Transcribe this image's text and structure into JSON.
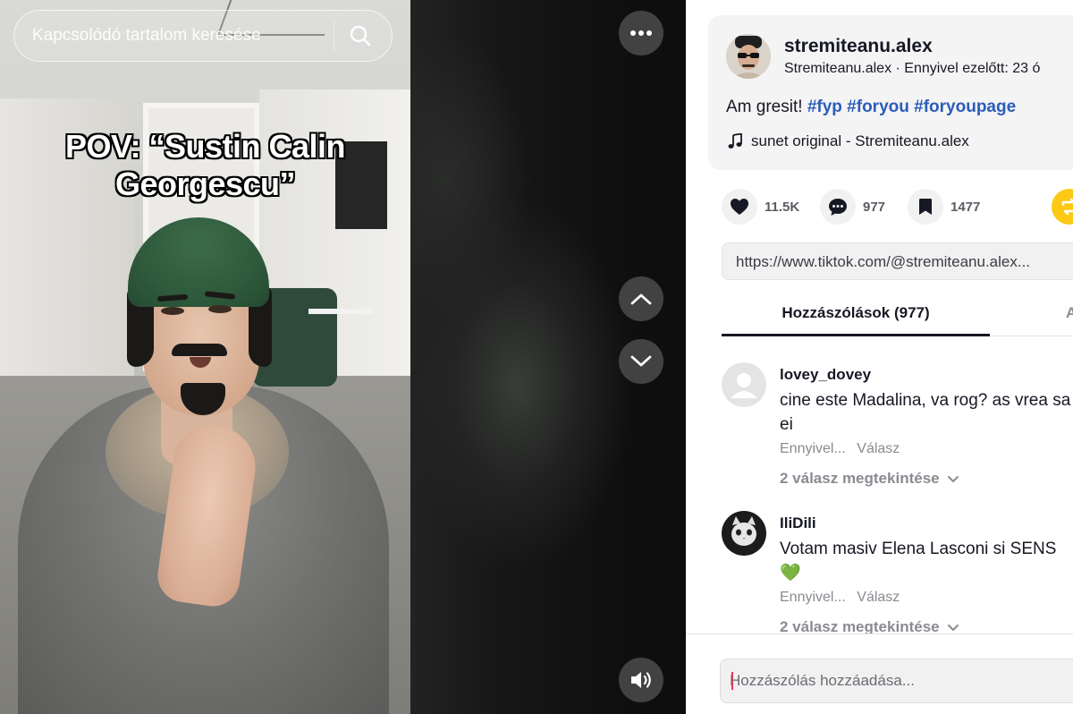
{
  "search": {
    "placeholder": "Kapcsolódó tartalom keresése"
  },
  "video": {
    "caption_lines": [
      "POV: “Sustin Calin",
      "Georgescu”"
    ]
  },
  "author": {
    "username": "stremiteanu.alex",
    "subline": "Stremiteanu.alex · Ennyivel ezelőtt: 23 ó"
  },
  "post": {
    "desc_text": "Am gresit!",
    "hashtags": [
      "#fyp",
      "#foryou",
      "#foryoupage"
    ],
    "music": "sunet original - Stremiteanu.alex"
  },
  "stats": {
    "likes": "11.5K",
    "comments": "977",
    "saves": "1477"
  },
  "link": {
    "url": "https://www.tiktok.com/@stremiteanu.alex..."
  },
  "tabs": {
    "comments_label": "Hozzászólások (977)",
    "second_label": "A"
  },
  "comments": [
    {
      "user": "lovey_dovey",
      "text": "cine este Madalina, va rog? as vrea sa ei",
      "time": "Ennyivel...",
      "reply": "Válasz",
      "more": "2 válasz megtekintése"
    },
    {
      "user": "IliDili",
      "text": "Votam masiv Elena Lasconi si SENS",
      "emoji": "💚",
      "time": "Ennyivel...",
      "reply": "Válasz",
      "more": "2 válasz megtekintése"
    }
  ],
  "composer": {
    "placeholder": "Hozzászólás hozzáadása..."
  },
  "colors": {
    "hashtag": "#2b5db9",
    "share_button": "#fec915",
    "caret": "#fe2c55"
  },
  "icons": {
    "search": "search-icon",
    "more": "more-dots-icon",
    "up": "chevron-up-icon",
    "down": "chevron-down-icon",
    "volume": "volume-icon",
    "like": "heart-icon",
    "comment": "comment-icon",
    "save": "bookmark-icon",
    "share": "share-icon",
    "music": "music-note-icon"
  }
}
